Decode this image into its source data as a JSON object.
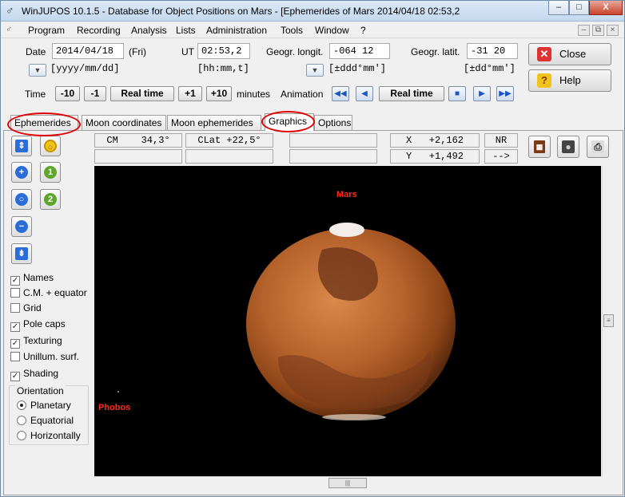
{
  "window": {
    "title": "WinJUPOS 10.1.5 - Database for Object Positions on Mars - [Ephemerides of Mars  2014/04/18  02:53,2",
    "app_icon": "mars-symbol-icon",
    "min": "–",
    "max": "□",
    "close": "X"
  },
  "menu": [
    "Program",
    "Recording",
    "Analysis",
    "Lists",
    "Administration",
    "Tools",
    "Window",
    "?"
  ],
  "mdi": {
    "min": "–",
    "restore": "⧉",
    "close": "×"
  },
  "date": {
    "label": "Date",
    "value": "2014/04/18",
    "weekday": "(Fri)",
    "format": "[yyyy/mm/dd]"
  },
  "ut": {
    "label": "UT",
    "value": "02:53,2",
    "format": "[hh:mm,t]"
  },
  "longit": {
    "label": "Geogr. longit.",
    "value": "-064 12",
    "format": "[±ddd°mm']"
  },
  "latit": {
    "label": "Geogr. latit.",
    "value": "-31 20",
    "format": "[±dd°mm']"
  },
  "buttons": {
    "close": "Close",
    "help": "Help"
  },
  "time": {
    "label": "Time",
    "m10": "-10",
    "m1": "-1",
    "real": "Real time",
    "p1": "+1",
    "p10": "+10",
    "unit": "minutes"
  },
  "animation": {
    "label": "Animation",
    "real": "Real time"
  },
  "tabs": [
    "Ephemerides",
    "Moon coordinates",
    "Moon ephemerides",
    "Graphics",
    "Options"
  ],
  "active_tab": "Graphics",
  "info": {
    "cm": "CM    34,3°",
    "clat": "CLat +22,5°",
    "x": "X   +2,162",
    "y": "Y   +1,492",
    "nr": "NR",
    "arrow": "-->"
  },
  "checks": [
    {
      "label": "Names",
      "checked": true
    },
    {
      "label": "C.M. + equator",
      "checked": false
    },
    {
      "label": "Grid",
      "checked": false
    },
    {
      "label": "Pole caps",
      "checked": true
    },
    {
      "label": "Texturing",
      "checked": true
    },
    {
      "label": "Unillum. surf.",
      "checked": false
    },
    {
      "label": "Shading",
      "checked": true
    }
  ],
  "orientation": {
    "label": "Orientation",
    "options": [
      "Planetary",
      "Equatorial",
      "Horizontally"
    ],
    "selected": "Planetary"
  },
  "canvas": {
    "mars_label": "Mars",
    "phobos_label": "Phobos"
  },
  "colors": {
    "label_red": "#ff2a1a",
    "highlight": "#e00000",
    "planet": "#b5622b"
  }
}
